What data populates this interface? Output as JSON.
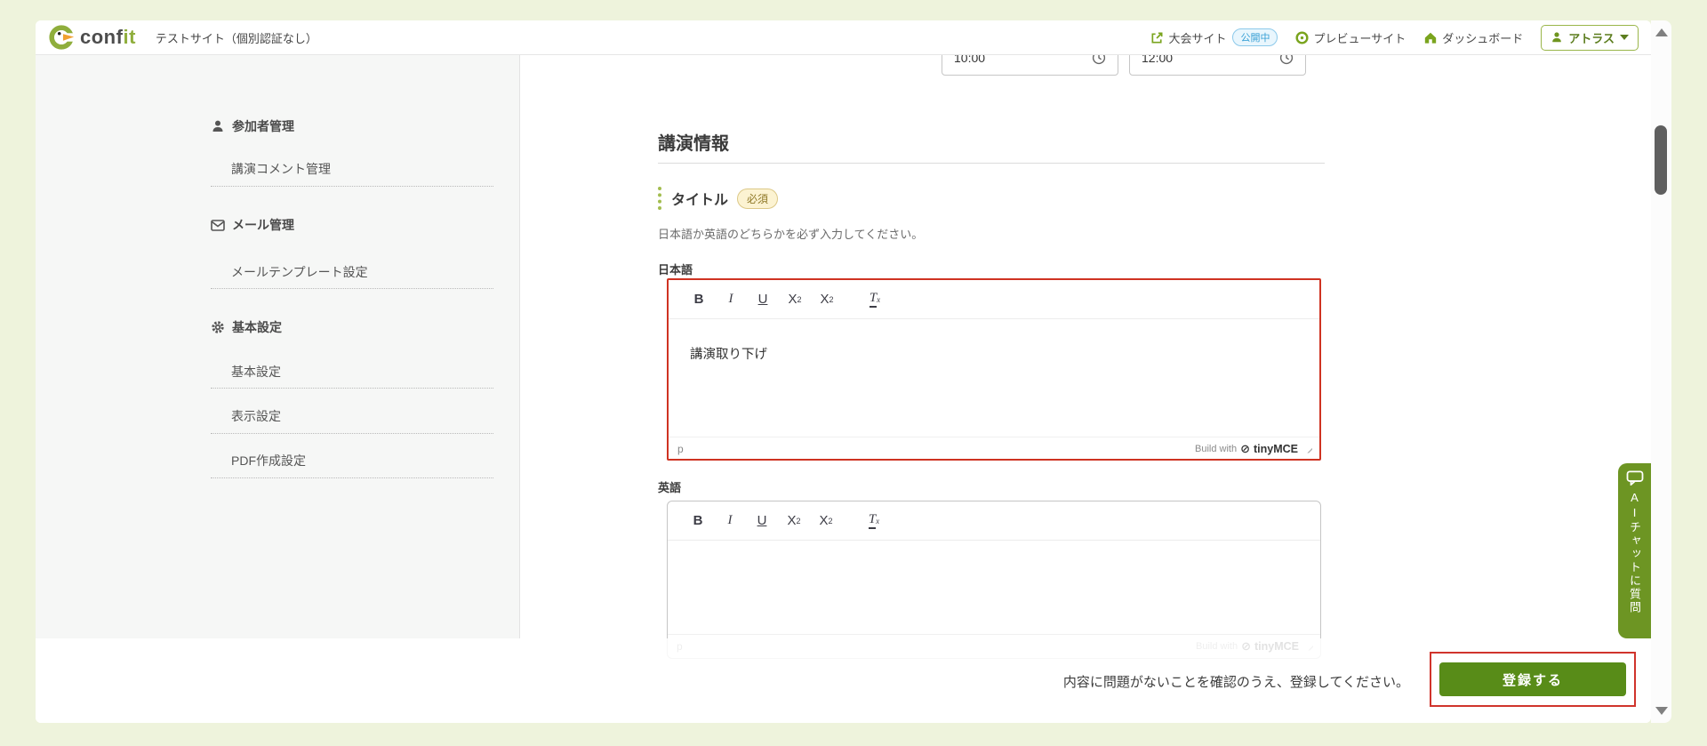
{
  "header": {
    "logo_main": "conf",
    "logo_accent": "it",
    "site_name": "テストサイト（個別認証なし）",
    "nav": {
      "event_site": "大会サイト",
      "event_badge": "公開中",
      "preview": "プレビューサイト",
      "dashboard": "ダッシュボード",
      "account": "アトラス"
    }
  },
  "sidebar": {
    "sections": [
      {
        "label": "参加者管理",
        "items": [
          "講演コメント管理"
        ]
      },
      {
        "label": "メール管理",
        "items": [
          "メールテンプレート設定"
        ]
      },
      {
        "label": "基本設定",
        "items": [
          "基本設定",
          "表示設定",
          "PDF作成設定"
        ]
      }
    ]
  },
  "content": {
    "time_start": "10:00",
    "time_end": "12:00",
    "section_heading": "講演情報",
    "field_label": "タイトル",
    "required_badge": "必須",
    "help": "日本語か英語のどちらかを必ず入力してください。",
    "ja_label": "日本語",
    "ja_text": "講演取り下げ",
    "en_label": "英語",
    "en_text": ""
  },
  "editor": {
    "bold": "B",
    "italic": "I",
    "underline": "U",
    "sup_base": "X",
    "sup_mark": "2",
    "sub_base": "X",
    "sub_mark": "2",
    "clear_base": "T",
    "clear_mark": "x",
    "status_element": "p",
    "brand_prefix": "Build with",
    "brand_mark": "⊘",
    "brand_name": "tinyMCE"
  },
  "footer": {
    "confirm": "内容に問題がないことを確認のうえ、登録してください。",
    "submit": "登録する"
  },
  "ai_chat": {
    "label": "AIチャットに質問"
  },
  "colors": {
    "accent_green": "#7aa41e",
    "logo_green": "#8fae3c",
    "button_green": "#588c18",
    "ai_tab_green": "#6d9523",
    "annotation_red": "#d0342c",
    "publish_badge_blue": "#39a0d5",
    "required_badge_yellow": "#8f7827",
    "page_background": "#eef3dc"
  }
}
